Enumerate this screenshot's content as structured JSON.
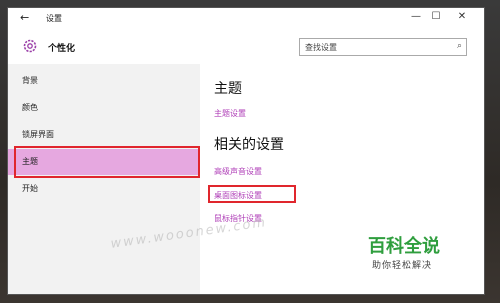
{
  "window": {
    "title": "设置",
    "back_icon": "back-arrow-icon",
    "controls": [
      "—",
      "☐",
      "✕"
    ]
  },
  "header": {
    "app_name": "个性化",
    "search": {
      "placeholder": "查找设置"
    }
  },
  "sidebar": {
    "items": [
      {
        "label": "背景",
        "selected": false
      },
      {
        "label": "颜色",
        "selected": false
      },
      {
        "label": "锁屏界面",
        "selected": false
      },
      {
        "label": "主题",
        "selected": true
      },
      {
        "label": "开始",
        "selected": false
      }
    ]
  },
  "content": {
    "theme_heading": "主题",
    "theme_link": "主题设置",
    "related_heading": "相关的设置",
    "related_links": [
      "高级声音设置",
      "桌面图标设置",
      "鼠标指针设置"
    ]
  },
  "overlay": {
    "watermark": "www.wooonew.com",
    "brand": "百科全说",
    "brand_sub": "助你轻松解决"
  },
  "colors": {
    "accent": "#b040b8",
    "selection": "#e6a8e0",
    "highlight_box": "#e0262d",
    "brand": "#2f9e3e"
  }
}
